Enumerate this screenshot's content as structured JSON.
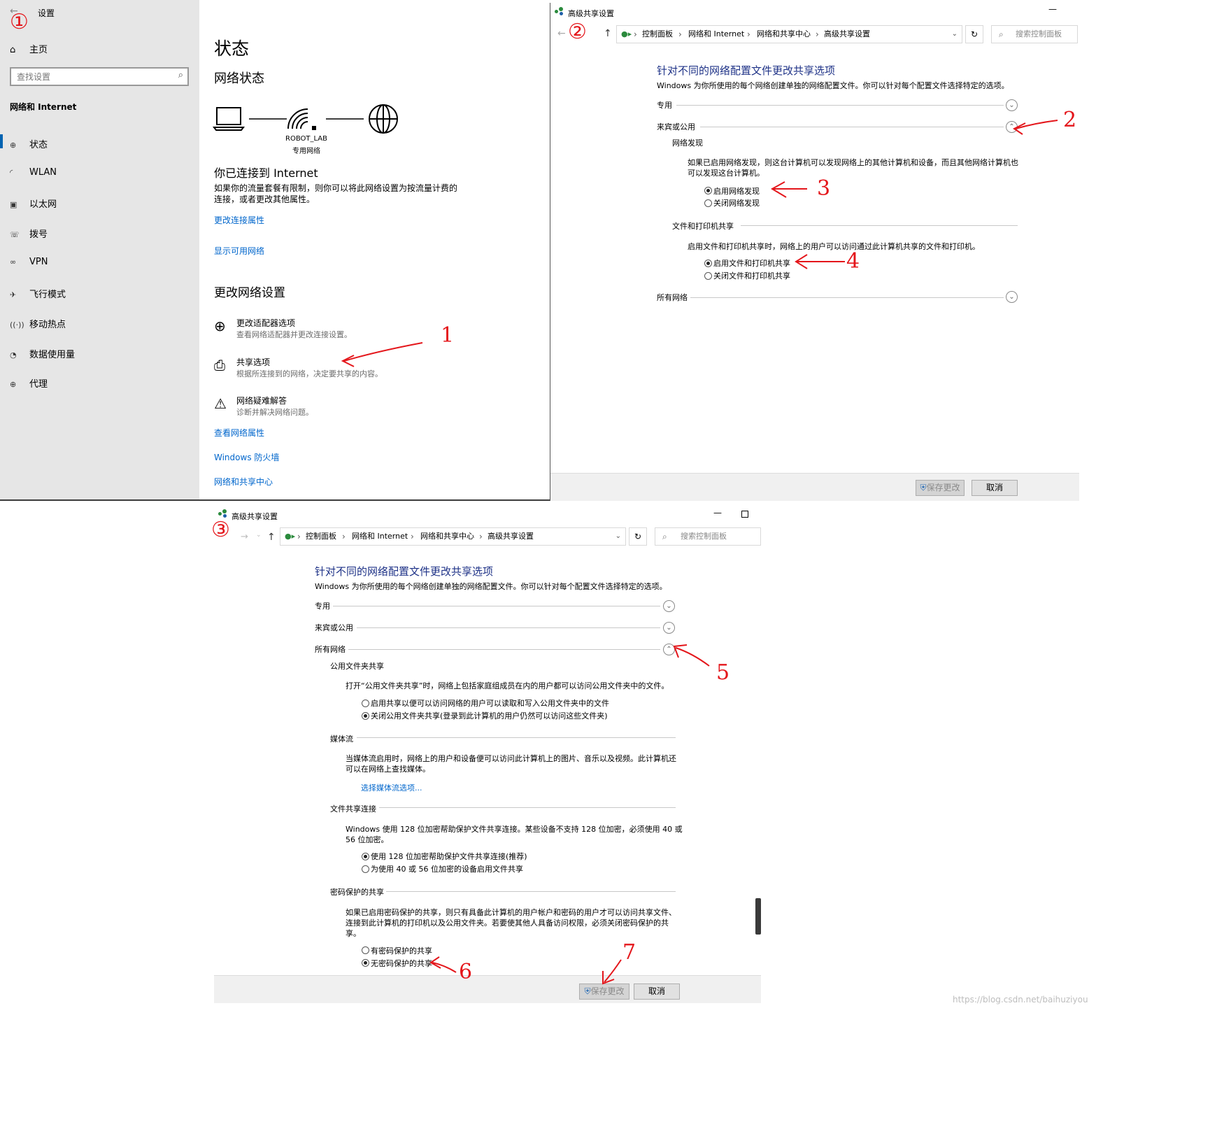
{
  "settings": {
    "window_title": "设置",
    "home": "主页",
    "search_placeholder": "查找设置",
    "category": "网络和 Internet",
    "nav": [
      {
        "label": "状态",
        "icon": "globe-status-icon",
        "glyph": "⊕"
      },
      {
        "label": "WLAN",
        "icon": "wifi-icon",
        "glyph": "◜"
      },
      {
        "label": "以太网",
        "icon": "ethernet-icon",
        "glyph": "▣"
      },
      {
        "label": "拨号",
        "icon": "dialup-icon",
        "glyph": "☏"
      },
      {
        "label": "VPN",
        "icon": "vpn-icon",
        "glyph": "∞"
      },
      {
        "label": "飞行模式",
        "icon": "airplane-icon",
        "glyph": "✈"
      },
      {
        "label": "移动热点",
        "icon": "hotspot-icon",
        "glyph": "((·))"
      },
      {
        "label": "数据使用量",
        "icon": "data-usage-icon",
        "glyph": "◔"
      },
      {
        "label": "代理",
        "icon": "proxy-icon",
        "glyph": "⊕"
      }
    ],
    "page_title": "状态",
    "network_status_heading": "网络状态",
    "network_name": "ROBOT_LAB",
    "network_type": "专用网络",
    "connected_heading": "你已连接到 Internet",
    "connected_desc_1": "如果你的流量套餐有限制，则你可以将此网络设置为按流量计费的",
    "connected_desc_2": "连接，或者更改其他属性。",
    "link_change_props": "更改连接属性",
    "link_show_networks": "显示可用网络",
    "change_settings_heading": "更改网络设置",
    "options": [
      {
        "title": "更改适配器选项",
        "desc": "查看网络适配器并更改连接设置。"
      },
      {
        "title": "共享选项",
        "desc": "根据所连接到的网络，决定要共享的内容。"
      },
      {
        "title": "网络疑难解答",
        "desc": "诊断并解决网络问题。"
      }
    ],
    "link_view_props": "查看网络属性",
    "link_firewall": "Windows 防火墙",
    "link_sharing_center": "网络和共享中心"
  },
  "cp1": {
    "window_title": "高级共享设置",
    "breadcrumb": [
      "控制面板",
      "网络和 Internet",
      "网络和共享中心",
      "高级共享设置"
    ],
    "search_placeholder": "搜索控制面板",
    "heading": "针对不同的网络配置文件更改共享选项",
    "subheading": "Windows 为你所使用的每个网络创建单独的网络配置文件。你可以针对每个配置文件选择特定的选项。",
    "profile_private": "专用",
    "profile_guest": "来宾或公用",
    "discovery_heading": "网络发现",
    "discovery_desc_1": "如果已启用网络发现，则这台计算机可以发现网络上的其他计算机和设备，而且其他网络计算机也",
    "discovery_desc_2": "可以发现这台计算机。",
    "discovery_on": "启用网络发现",
    "discovery_off": "关闭网络发现",
    "fps_heading": "文件和打印机共享",
    "fps_desc": "启用文件和打印机共享时，网络上的用户可以访问通过此计算机共享的文件和打印机。",
    "fps_on": "启用文件和打印机共享",
    "fps_off": "关闭文件和打印机共享",
    "profile_all": "所有网络",
    "save": "保存更改",
    "cancel": "取消"
  },
  "cp2": {
    "window_title": "高级共享设置",
    "breadcrumb": [
      "控制面板",
      "网络和 Internet",
      "网络和共享中心",
      "高级共享设置"
    ],
    "search_placeholder": "搜索控制面板",
    "heading": "针对不同的网络配置文件更改共享选项",
    "subheading": "Windows 为你所使用的每个网络创建单独的网络配置文件。你可以针对每个配置文件选择特定的选项。",
    "profile_private": "专用",
    "profile_guest": "来宾或公用",
    "profile_all": "所有网络",
    "public_heading": "公用文件夹共享",
    "public_desc": "打开“公用文件夹共享”时，网络上包括家庭组成员在内的用户都可以访问公用文件夹中的文件。",
    "public_on": "启用共享以便可以访问网络的用户可以读取和写入公用文件夹中的文件",
    "public_off": "关闭公用文件夹共享(登录到此计算机的用户仍然可以访问这些文件夹)",
    "media_heading": "媒体流",
    "media_desc_1": "当媒体流启用时，网络上的用户和设备便可以访问此计算机上的图片、音乐以及视频。此计算机还",
    "media_desc_2": "可以在网络上查找媒体。",
    "media_link": "选择媒体流选项...",
    "conn_heading": "文件共享连接",
    "conn_desc_1": "Windows 使用 128 位加密帮助保护文件共享连接。某些设备不支持 128 位加密，必须使用 40 或",
    "conn_desc_2": "56 位加密。",
    "conn_128": "使用 128 位加密帮助保护文件共享连接(推荐)",
    "conn_40": "为使用 40 或 56 位加密的设备启用文件共享",
    "pwd_heading": "密码保护的共享",
    "pwd_desc_1": "如果已启用密码保护的共享，则只有具备此计算机的用户帐户和密码的用户才可以访问共享文件、",
    "pwd_desc_2": "连接到此计算机的打印机以及公用文件夹。若要使其他人具备访问权限，必须关闭密码保护的共",
    "pwd_desc_3": "享。",
    "pwd_on": "有密码保护的共享",
    "pwd_off": "无密码保护的共享",
    "save": "保存更改",
    "cancel": "取消"
  },
  "annotations": {
    "a1": "1",
    "a2": "2",
    "a3": "3",
    "a4": "4",
    "a5": "5",
    "a6": "6",
    "a7": "7",
    "c1": "①",
    "c2": "②",
    "c3": "③"
  },
  "watermark": "https://blog.csdn.net/baihuziyou",
  "colors": {
    "link": "#0066cc",
    "annotation": "#e4161b",
    "heading_blue": "#1e3287",
    "sidebar_bg": "#e6e6e6"
  }
}
